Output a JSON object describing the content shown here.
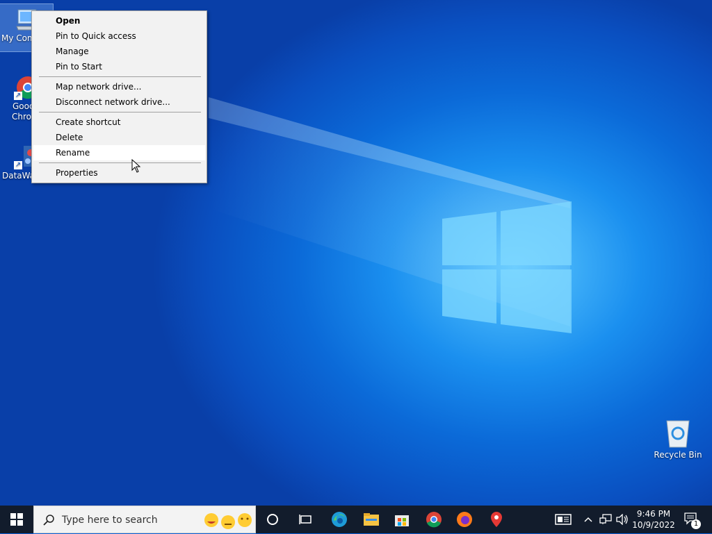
{
  "desktop": {
    "icons": [
      {
        "label": "My Com"
      },
      {
        "label": "Good",
        "label2": "Chro"
      },
      {
        "label": "DataWagon..."
      },
      {
        "label": "Recycle Bin"
      }
    ]
  },
  "context_menu": {
    "items": [
      {
        "label": "Open",
        "bold": true
      },
      {
        "label": "Pin to Quick access"
      },
      {
        "label": "Manage"
      },
      {
        "label": "Pin to Start"
      },
      {
        "label": "Map network drive..."
      },
      {
        "label": "Disconnect network drive..."
      },
      {
        "label": "Create shortcut"
      },
      {
        "label": "Delete"
      },
      {
        "label": "Rename",
        "hovered": true
      },
      {
        "label": "Properties"
      }
    ]
  },
  "taskbar": {
    "search_placeholder": "Type here to search",
    "time": "9:46 PM",
    "date": "10/9/2022",
    "notification_count": "1",
    "colors": {
      "taskbar_bg": "#121c2c",
      "accent": "#0078d7"
    }
  }
}
